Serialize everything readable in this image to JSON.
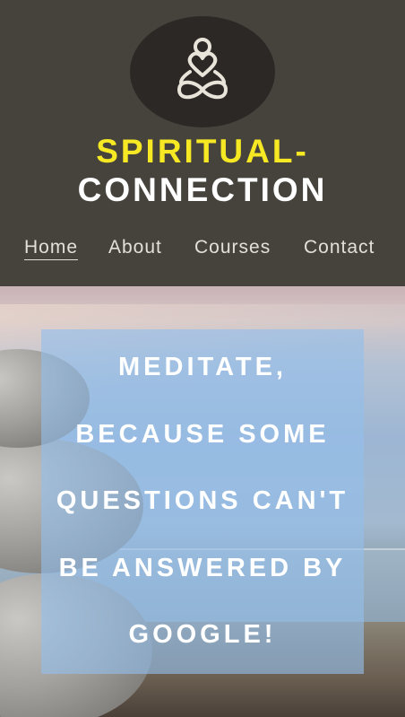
{
  "brand": {
    "logo_icon": "meditation-heart-infinity-icon",
    "line1": "SPIRITUAL-",
    "line2": "CONNECTION",
    "accent_color": "#f6e923"
  },
  "nav": {
    "items": [
      {
        "label": "Home",
        "active": true
      },
      {
        "label": "About",
        "active": false
      },
      {
        "label": "Courses",
        "active": false
      },
      {
        "label": "Contact",
        "active": false
      }
    ]
  },
  "hero": {
    "quote_lines": [
      "MEDITATE,",
      "BECAUSE SOME",
      "QUESTIONS CAN'T",
      "BE ANSWERED BY",
      "GOOGLE!"
    ]
  }
}
